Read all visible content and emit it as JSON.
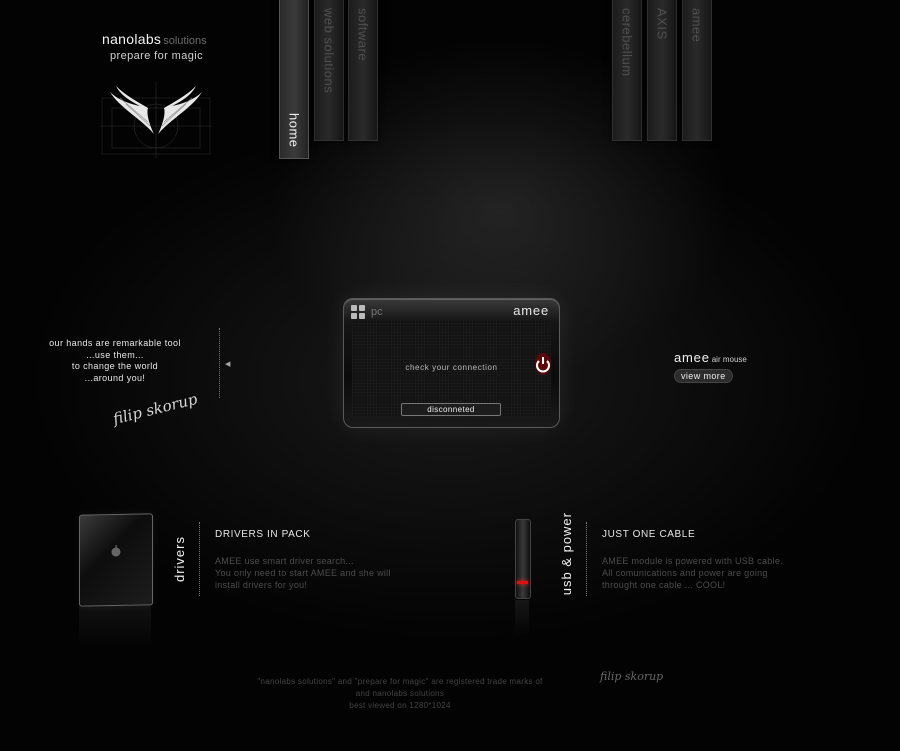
{
  "brand": {
    "name": "nanolabs",
    "name_suffix": "solutions",
    "tagline": "prepare for magic"
  },
  "nav": {
    "left": [
      {
        "label": "home",
        "active": true
      },
      {
        "label": "web solutions",
        "active": false
      },
      {
        "label": "software",
        "active": false
      }
    ],
    "right": [
      {
        "label": "cerebellum",
        "active": false
      },
      {
        "label": "AXIS",
        "active": false
      },
      {
        "label": "amee",
        "active": false
      }
    ]
  },
  "device": {
    "tab": "pc",
    "title": "amee",
    "message": "check your connection",
    "status": "disconneted"
  },
  "quote": {
    "lines": [
      "our hands are remarkable tool",
      "...use them...",
      "to change the world",
      "...around you!"
    ],
    "signature": "filip skorup"
  },
  "product": {
    "title": "amee",
    "subtitle": "air mouse",
    "cta": "view more"
  },
  "features": [
    {
      "side_label": "drivers",
      "heading": "DRIVERS IN PACK",
      "body": [
        "AMEE use smart driver search...",
        "You only need to start AMEE and she will",
        "install drivers for you!"
      ]
    },
    {
      "side_label": "usb & power",
      "heading": "JUST ONE CABLE",
      "body": [
        "AMEE module is powered with USB cable.",
        "All comunications and power are going",
        "throught one cable ... COOL!"
      ]
    }
  ],
  "footer": {
    "lines": [
      "\"nanolabs solutions\" and \"prepare for magic\" are registered trade marks of",
      "and nanolabs solutions",
      "best viewed on 1280*1024"
    ],
    "signature": "filip skorup"
  },
  "colors": {
    "background": "#000000",
    "accent_power": "#d11111",
    "text_primary": "#f2f2f2",
    "text_muted": "#4c4c4c"
  }
}
